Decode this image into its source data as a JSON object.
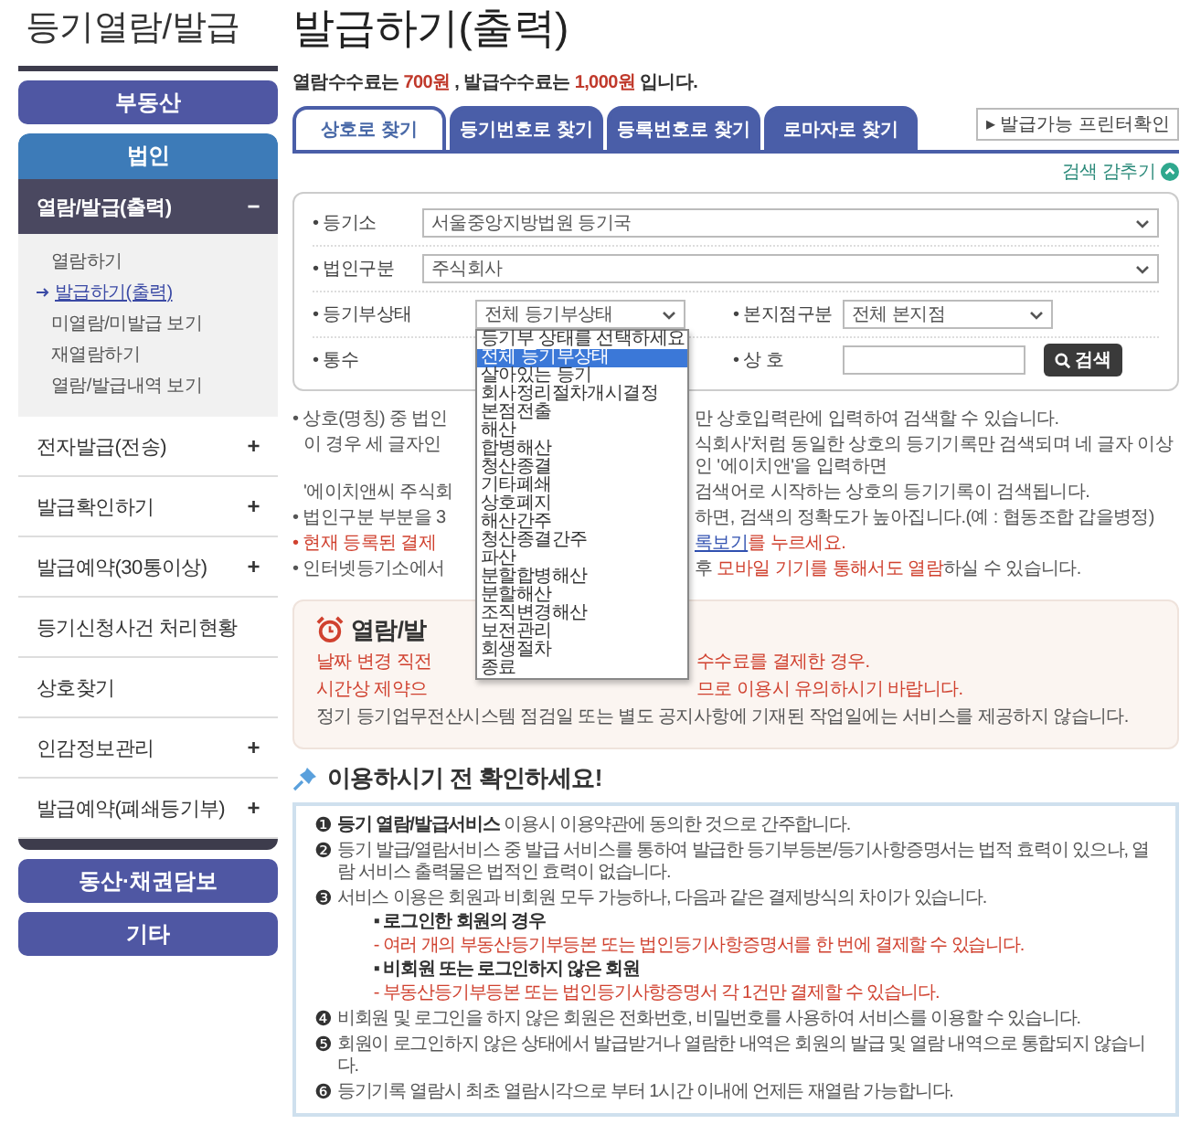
{
  "sidebar": {
    "title": "등기열람/발급",
    "top_buttons": [
      {
        "label": "부동산"
      }
    ],
    "section": {
      "label": "법인",
      "group": {
        "label": "열람/발급(출력)",
        "sign": "−",
        "items": [
          {
            "label": "열람하기",
            "selected": false
          },
          {
            "label": "발급하기(출력)",
            "selected": true
          },
          {
            "label": "미열람/미발급 보기",
            "selected": false
          },
          {
            "label": "재열람하기",
            "selected": false
          },
          {
            "label": "열람/발급내역 보기",
            "selected": false
          }
        ]
      },
      "items": [
        {
          "label": "전자발급(전송)",
          "sign": "+"
        },
        {
          "label": "발급확인하기",
          "sign": "+"
        },
        {
          "label": "발급예약(30통이상)",
          "sign": "+"
        },
        {
          "label": "등기신청사건 처리현황"
        },
        {
          "label": "상호찾기"
        },
        {
          "label": "인감정보관리",
          "sign": "+"
        },
        {
          "label": "발급예약(폐쇄등기부)",
          "sign": "+"
        }
      ]
    },
    "bottom_buttons": [
      {
        "label": "동산·채권담보"
      },
      {
        "label": "기타"
      }
    ]
  },
  "page_title": "발급하기(출력)",
  "fee_notice": "열람수수료는 **700원** , 발급수수료는 **1,000원** 입니다.",
  "tabs": [
    {
      "label": "상호로 찾기",
      "selected": true
    },
    {
      "label": "등기번호로 찾기",
      "selected": false
    },
    {
      "label": "등록번호로 찾기",
      "selected": false
    },
    {
      "label": "로마자로 찾기",
      "selected": false
    }
  ],
  "printer_button": "▸ 발급가능 프린터확인",
  "toggle_link": "검색 감추기",
  "form": {
    "rows": [
      [
        {
          "kind": "select",
          "label": "• 등기소",
          "value": "서울중앙지방법원 등기국"
        }
      ],
      [
        {
          "kind": "select",
          "label": "• 법인구분",
          "value": "주식회사"
        }
      ],
      [
        {
          "kind": "select",
          "label": "• 등기부상태",
          "value": "전체 등기부상태",
          "expanded": true
        },
        {
          "kind": "select",
          "label": "• 본지점구분",
          "value": "전체 본지점"
        }
      ],
      [
        {
          "kind": "covered",
          "label": "• 통수"
        },
        {
          "kind": "text",
          "label": "• 상 호",
          "button": "검색"
        }
      ]
    ],
    "dropdown_options": [
      {
        "label": "등기부 상태를 선택하세요",
        "selected": false
      },
      {
        "label": "전체 등기부상태",
        "selected": true
      },
      {
        "label": "살아있는 등기",
        "selected": false
      },
      {
        "label": "회사정리절차개시결정",
        "selected": false
      },
      {
        "label": "본점전출",
        "selected": false
      },
      {
        "label": "해산",
        "selected": false
      },
      {
        "label": "합병해산",
        "selected": false
      },
      {
        "label": "청산종결",
        "selected": false
      },
      {
        "label": "기타폐쇄",
        "selected": false
      },
      {
        "label": "상호폐지",
        "selected": false
      },
      {
        "label": "해산간주",
        "selected": false
      },
      {
        "label": "청산종결간주",
        "selected": false
      },
      {
        "label": "파산",
        "selected": false
      },
      {
        "label": "분할합병해산",
        "selected": false
      },
      {
        "label": "분할해산",
        "selected": false
      },
      {
        "label": "조직변경해산",
        "selected": false
      },
      {
        "label": "보전관리",
        "selected": false
      },
      {
        "label": "회생절차",
        "selected": false
      },
      {
        "label": "종료",
        "selected": false
      }
    ]
  },
  "notices": [
    {
      "kind": "bullet",
      "left": [
        {
          "kind": "plain",
          "text": "• 상호(명칭) 중 법인"
        }
      ],
      "right": [
        {
          "kind": "plain",
          "text": "만 상호입력란에 입력하여 검색할 수 있습니다."
        }
      ]
    },
    {
      "kind": "continuation",
      "left": [
        {
          "kind": "plain",
          "text": "이 경우 세 글자인"
        }
      ],
      "right": [
        {
          "kind": "plain",
          "text": "식회사'처럼 동일한 상호의 등기기록만 검색되며 네 글자 이상인 '에이치앤'을 입력하면"
        }
      ]
    },
    {
      "kind": "continuation",
      "left": [
        {
          "kind": "plain",
          "text": "'에이치앤씨 주식회"
        }
      ],
      "right": [
        {
          "kind": "plain",
          "text": "검색어로 시작하는 상호의 등기기록이 검색됩니다."
        }
      ]
    },
    {
      "kind": "bullet",
      "left": [
        {
          "kind": "plain",
          "text": "• 법인구분 부분을 3"
        }
      ],
      "right": [
        {
          "kind": "plain",
          "text": "하면, 검색의 정확도가 높아집니다.(예 : 협동조합 갑을병정)"
        }
      ]
    },
    {
      "kind": "bullet",
      "left": [
        {
          "kind": "red",
          "text": "• 현재 등록된 결제"
        }
      ],
      "right": [
        {
          "kind": "link",
          "text": "록보기"
        },
        {
          "kind": "red",
          "text": "를 누르세요."
        }
      ]
    },
    {
      "kind": "bullet",
      "left": [
        {
          "kind": "plain",
          "text": "• 인터넷등기소에서"
        }
      ],
      "right": [
        {
          "kind": "plain",
          "text": "후 "
        },
        {
          "kind": "red",
          "text": "모바일 기기를 통해서도 열람"
        },
        {
          "kind": "plain",
          "text": "하실 수 있습니다."
        }
      ]
    }
  ],
  "alarm_box": {
    "title": "열람/발",
    "lines": [
      {
        "kind": "split",
        "red": true,
        "left": "날짜 변경 직전",
        "right": "수수료를 결제한 경우."
      },
      {
        "kind": "split",
        "red": true,
        "left": "시간상 제약으",
        "right": "므로 이용시 유의하시기 바랍니다."
      },
      {
        "kind": "full",
        "red": false,
        "text": "정기 등기업무전산시스템 점검일 또는 별도 공지사항에 기재된 작업일에는 서비스를 제공하지 않습니다."
      }
    ]
  },
  "checklist": {
    "title": "이용하시기 전 확인하세요!",
    "items": [
      {
        "num": "❶",
        "text": "**등기 열람/발급서비스** 이용시 이용약관에 동의한 것으로 간주합니다."
      },
      {
        "num": "❷",
        "text": "등기 발급/열람서비스 중 발급 서비스를 통하여 발급한 등기부등본/등기사항증명서는 법적 효력이 있으나, 열람 서비스 출력물은 법적인 효력이 없습니다."
      },
      {
        "num": "❸",
        "text": "서비스 이용은 회원과 비회원 모두 가능하나, 다음과 같은 결제방식의 차이가 있습니다.",
        "subitems": [
          {
            "kind": "heading",
            "text": "▪ 로그인한 회원의 경우"
          },
          {
            "kind": "note",
            "text": "- 여러 개의 부동산등기부등본 또는 법인등기사항증명서를 한 번에 결제할 수 있습니다."
          },
          {
            "kind": "heading",
            "text": "▪ 비회원 또는 로그인하지 않은 회원"
          },
          {
            "kind": "note",
            "text": "- 부동산등기부등본 또는 법인등기사항증명서 각 1건만 결제할 수 있습니다."
          }
        ]
      },
      {
        "num": "❹",
        "text": "비회원 및 로그인을 하지 않은 회원은 전화번호, 비밀번호를 사용하여 서비스를 이용할 수 있습니다."
      },
      {
        "num": "❺",
        "text": "회원이 로그인하지 않은 상태에서 발급받거나 열람한 내역은 회원의 발급 및 열람 내역으로 통합되지 않습니다."
      },
      {
        "num": "❻",
        "text": "등기기록 열람시 최초 열람시각으로 부터 1시간 이내에 언제든 재열람 가능합니다."
      }
    ]
  }
}
